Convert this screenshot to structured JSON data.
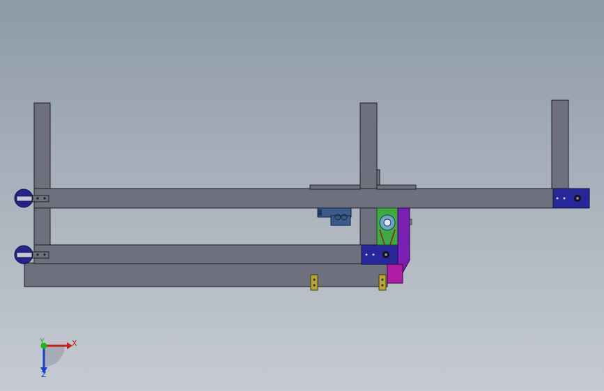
{
  "viewport": {
    "background_top": "#8e9aa8",
    "background_bottom": "#c6cbd2"
  },
  "model": {
    "frame_color": "#6e707e",
    "frame_edge": "#1e1e24",
    "bracket_blue": "#27279a",
    "motor_blue": "#3c5a8c",
    "gear_green": "#3faa3f",
    "arm_purple": "#7a20b4",
    "arm_magenta": "#b01ca8",
    "post_yellow": "#b8a830"
  },
  "triad": {
    "x_label": "X",
    "y_label": "Y",
    "z_label": "Z",
    "x_color": "#c81e1e",
    "y_color": "#1eb41e",
    "z_color": "#1e3cc8"
  }
}
